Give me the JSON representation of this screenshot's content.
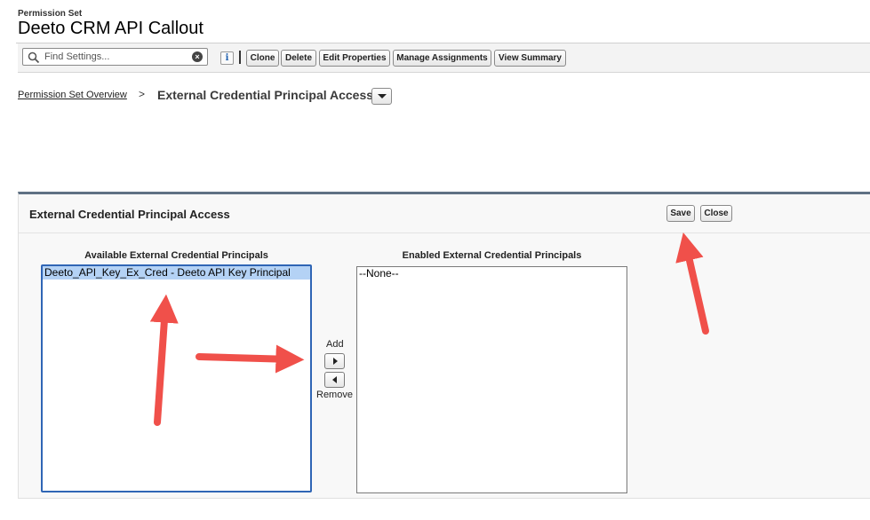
{
  "header": {
    "subtitle": "Permission Set",
    "title": "Deeto CRM API Callout"
  },
  "toolbar": {
    "search_placeholder": "Find Settings...",
    "info_label": "i",
    "buttons": [
      "Clone",
      "Delete",
      "Edit Properties",
      "Manage Assignments",
      "View Summary"
    ]
  },
  "breadcrumb": {
    "link": "Permission Set Overview",
    "separator": ">",
    "current": "External Credential Principal Access"
  },
  "panel": {
    "title": "External Credential Principal Access",
    "save_label": "Save",
    "close_label": "Close",
    "available_label": "Available External Credential Principals",
    "enabled_label": "Enabled External Credential Principals",
    "available_options": [
      "Deeto_API_Key_Ex_Cred - Deeto API Key Principal"
    ],
    "enabled_options": [
      "--None--"
    ],
    "add_label": "Add",
    "remove_label": "Remove"
  },
  "annotation_color": "#f0504a"
}
